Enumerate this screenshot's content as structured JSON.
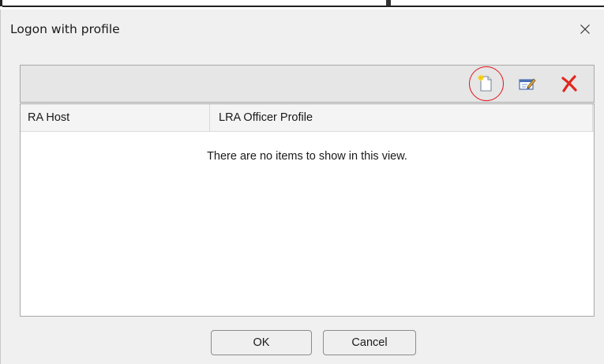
{
  "window": {
    "title": "Logon with profile"
  },
  "toolbar": {
    "icons": [
      "new-document-icon",
      "edit-icon",
      "delete-icon"
    ],
    "highlight_color": "#e0121a"
  },
  "list": {
    "columns": [
      "RA Host",
      "LRA Officer Profile"
    ],
    "empty_message": "There are no items to show in this view."
  },
  "buttons": {
    "ok_label": "OK",
    "cancel_label": "Cancel"
  }
}
